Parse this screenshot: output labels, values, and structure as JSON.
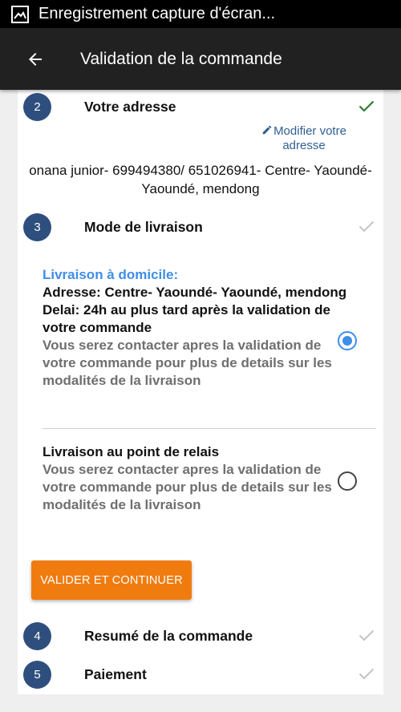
{
  "status_bar": {
    "text": "Enregistrement capture d'écran..."
  },
  "app_bar": {
    "title": "Validation de la commande"
  },
  "steps": {
    "address": {
      "number": "2",
      "label": "Votre adresse"
    },
    "delivery": {
      "number": "3",
      "label": "Mode de livraison"
    },
    "summary": {
      "number": "4",
      "label": "Resumé de la commande"
    },
    "payment": {
      "number": "5",
      "label": "Paiement"
    }
  },
  "address": {
    "modify_link": "Modifier votre adresse",
    "text": "onana junior- 699494380/ 651026941- Centre- Yaoundé- Yaoundé, mendong"
  },
  "delivery_options": {
    "home": {
      "title": "Livraison à domicile:",
      "address": "Adresse: Centre- Yaoundé- Yaoundé, mendong",
      "delay": "Delai: 24h au plus tard après la validation de votre commande",
      "note": "Vous serez contacter apres la validation de votre commande pour plus de details sur les modalités de la livraison",
      "selected": true
    },
    "relay": {
      "title": "Livraison au point de relais",
      "note": "Vous serez contacter apres la validation de votre commande pour plus de details sur les modalités de la livraison",
      "selected": false
    }
  },
  "validate_button": "VALIDER ET CONTINUER",
  "colors": {
    "accent": "#3f8ee8",
    "button": "#f07c10",
    "step_circle": "#2e4f7e",
    "check_done": "#2e7d32",
    "check_pending": "#c4c4c4"
  }
}
